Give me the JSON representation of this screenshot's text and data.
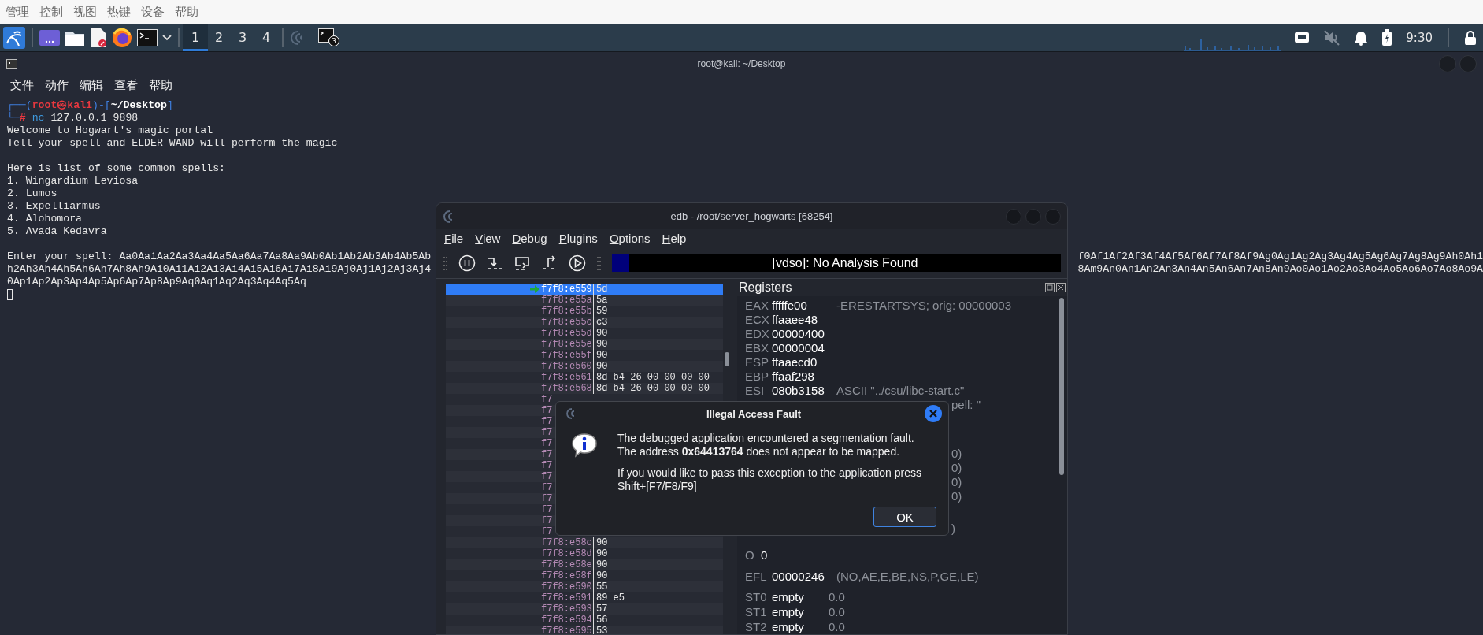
{
  "host_menu": [
    "管理",
    "控制",
    "视图",
    "热键",
    "设备",
    "帮助"
  ],
  "taskbar": {
    "workspaces": [
      {
        "label": "1",
        "selected": true
      },
      {
        "label": "2",
        "selected": false
      },
      {
        "label": "3",
        "selected": false
      },
      {
        "label": "4",
        "selected": false
      }
    ],
    "window_badge": "3",
    "audio_muted": true,
    "clock": "9:30"
  },
  "terminal": {
    "title": "root@kali: ~/Desktop",
    "menu": [
      "文件",
      "动作",
      "编辑",
      "查看",
      "帮助"
    ],
    "prompt": [
      [
        {
          "kind": "frame",
          "text": "┌──("
        },
        {
          "kind": "user",
          "text": "root㉿kali"
        },
        {
          "kind": "frame",
          "text": ")-["
        },
        {
          "kind": "path",
          "text": "~/Desktop"
        },
        {
          "kind": "frame",
          "text": "]"
        }
      ],
      [
        {
          "kind": "frame",
          "text": "└─"
        },
        {
          "kind": "symbol",
          "text": "#"
        },
        {
          "kind": "command",
          "text": " nc"
        },
        {
          "kind": "plain",
          "text": " 127.0.0.1 9898"
        }
      ]
    ],
    "output_blocks": [
      [
        "Welcome to Hogwart's magic portal",
        "Tell your spell and ELDER WAND will perform the magic"
      ],
      [
        "Here is list of some common spells:",
        "1. Wingardium Leviosa",
        "2. Lumos",
        "3. Expelliarmus",
        "4. Alohomora",
        "5. Avada Kedavra"
      ]
    ],
    "spell_lines": [
      {
        "left": "Enter your spell: Aa0Aa1Aa2Aa3Aa4Aa5Aa6Aa7Aa8Aa9Ab0Ab1Ab2Ab3Ab4Ab5Ab",
        "right": "f0Af1Af2Af3Af4Af5Af6Af7Af8Af9Ag0Ag1Ag2Ag3Ag4Ag5Ag6Ag7Ag8Ag9Ah0Ah1"
      },
      {
        "left": "h2Ah3Ah4Ah5Ah6Ah7Ah8Ah9Ai0Ai1Ai2Ai3Ai4Ai5Ai6Ai7Ai8Ai9Aj0Aj1Aj2Aj3Aj4",
        "right": "8Am9An0An1An2An3An4An5An6An7An8An9Ao0Ao1Ao2Ao3Ao4Ao5Ao6Ao7Ao8Ao9A"
      },
      {
        "left": "0Ap1Ap2Ap3Ap4Ap5Ap6Ap7Ap8Ap9Aq0Aq1Aq2Aq3Aq4Aq5Aq"
      }
    ]
  },
  "edb": {
    "title": "edb - /root/server_hogwarts [68254]",
    "menu": [
      "File",
      "View",
      "Debug",
      "Plugins",
      "Options",
      "Help"
    ],
    "status": "[vdso]: No Analysis Found",
    "disassembly": [
      {
        "address": "f7f8:e559",
        "bytes": "5d",
        "selected": true,
        "current": true
      },
      {
        "address": "f7f8:e55a",
        "bytes": "5a",
        "selected": false,
        "current": false
      },
      {
        "address": "f7f8:e55b",
        "bytes": "59",
        "selected": false,
        "current": false
      },
      {
        "address": "f7f8:e55c",
        "bytes": "c3",
        "selected": false,
        "current": false
      },
      {
        "address": "f7f8:e55d",
        "bytes": "90",
        "selected": false,
        "current": false
      },
      {
        "address": "f7f8:e55e",
        "bytes": "90",
        "selected": false,
        "current": false
      },
      {
        "address": "f7f8:e55f",
        "bytes": "90",
        "selected": false,
        "current": false
      },
      {
        "address": "f7f8:e560",
        "bytes": "90",
        "selected": false,
        "current": false
      },
      {
        "address": "f7f8:e561",
        "bytes": "8d b4 26 00 00 00 00",
        "selected": false,
        "current": false
      },
      {
        "address": "f7f8:e568",
        "bytes": "8d b4 26 00 00 00 00",
        "selected": false,
        "current": false
      },
      {
        "address": "f7",
        "selected": false,
        "current": false
      },
      {
        "address": "f7",
        "selected": false,
        "current": false
      },
      {
        "address": "f7",
        "selected": false,
        "current": false
      },
      {
        "address": "f7",
        "selected": false,
        "current": false
      },
      {
        "address": "f7",
        "selected": false,
        "current": false
      },
      {
        "address": "f7",
        "selected": false,
        "current": false
      },
      {
        "address": "f7",
        "selected": false,
        "current": false
      },
      {
        "address": "f7",
        "selected": false,
        "current": false
      },
      {
        "address": "f7",
        "selected": false,
        "current": false
      },
      {
        "address": "f7",
        "selected": false,
        "current": false
      },
      {
        "address": "f7",
        "selected": false,
        "current": false
      },
      {
        "address": "f7",
        "selected": false,
        "current": false
      },
      {
        "address": "f7",
        "selected": false,
        "current": false
      },
      {
        "address": "f7f8:e58c",
        "bytes": "90",
        "selected": false,
        "current": false
      },
      {
        "address": "f7f8:e58d",
        "bytes": "90",
        "selected": false,
        "current": false
      },
      {
        "address": "f7f8:e58e",
        "bytes": "90",
        "selected": false,
        "current": false
      },
      {
        "address": "f7f8:e58f",
        "bytes": "90",
        "selected": false,
        "current": false
      },
      {
        "address": "f7f8:e590",
        "bytes": "55",
        "selected": false,
        "current": false
      },
      {
        "address": "f7f8:e591",
        "bytes": "89 e5",
        "selected": false,
        "current": false
      },
      {
        "address": "f7f8:e593",
        "bytes": "57",
        "selected": false,
        "current": false
      },
      {
        "address": "f7f8:e594",
        "bytes": "56",
        "selected": false,
        "current": false
      },
      {
        "address": "f7f8:e595",
        "bytes": "53",
        "selected": false,
        "current": false
      }
    ],
    "registers": {
      "title": "Registers",
      "general": [
        {
          "name": "EAX",
          "value": "fffffe00",
          "comment": "-ERESTARTSYS; orig: 00000003"
        },
        {
          "name": "ECX",
          "value": "ffaaee48"
        },
        {
          "name": "EDX",
          "value": "00000400"
        },
        {
          "name": "EBX",
          "value": "00000004"
        },
        {
          "name": "ESP",
          "value": "ffaaecd0"
        },
        {
          "name": "EBP",
          "value": "ffaaf298"
        },
        {
          "name": "ESI",
          "value": "080b3158",
          "comment": "ASCII \"../csu/libc-start.c\""
        }
      ],
      "covered": [
        "pell: \"",
        "0)",
        "0)",
        "0)",
        "0)",
        ")"
      ],
      "flags": [
        {
          "name": "O",
          "value": "0"
        }
      ],
      "efl": {
        "name": "EFL",
        "value": "00000246",
        "comment": "(NO,AE,E,BE,NS,P,GE,LE)"
      },
      "fpu": [
        {
          "name": "ST0",
          "value": "empty",
          "comment": "0.0"
        },
        {
          "name": "ST1",
          "value": "empty",
          "comment": "0.0"
        },
        {
          "name": "ST2",
          "value": "empty",
          "comment": "0.0"
        }
      ]
    },
    "fault_dialog": {
      "title": "Illegal Access Fault",
      "lines": [
        "The debugged application encountered a segmentation fault.",
        "The address **0x64413764** does not appear to be mapped."
      ],
      "hint": "If you would like to pass this exception to the application press Shift+[F7/F8/F9]",
      "button": "OK"
    }
  }
}
